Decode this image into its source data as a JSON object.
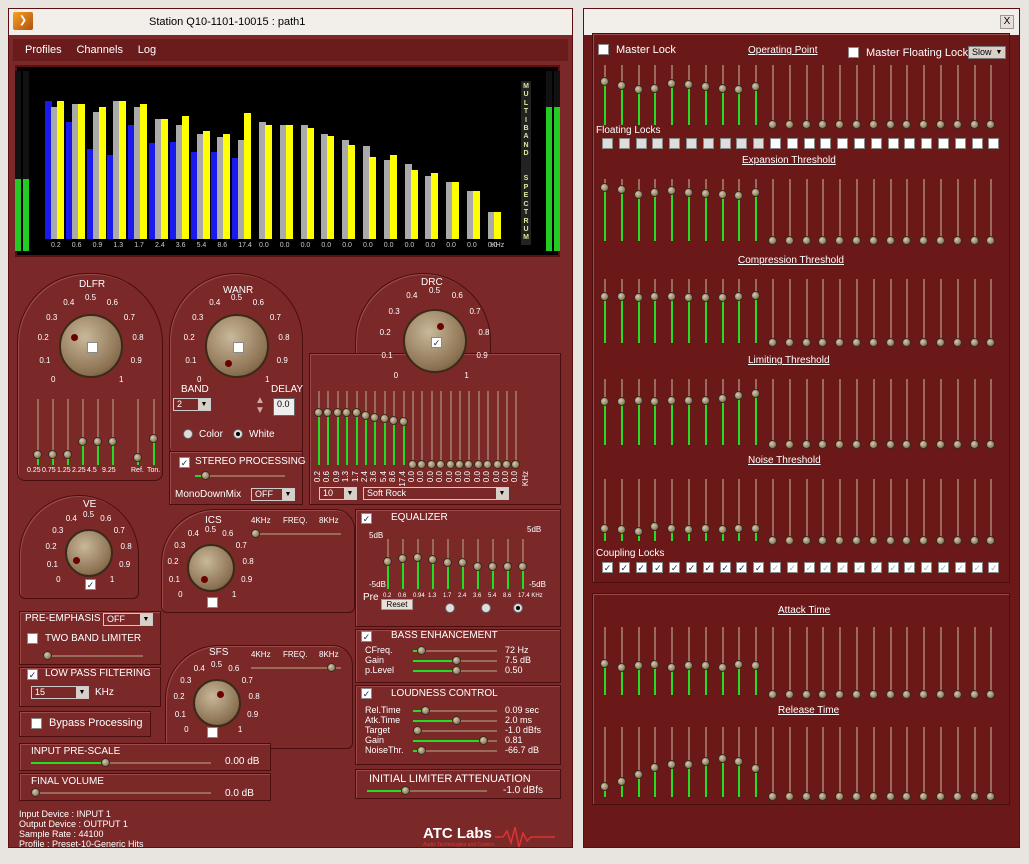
{
  "window": {
    "title": "Station  Q10-1101-10015 :  path1",
    "close": "X"
  },
  "menu": [
    "Profiles",
    "Channels",
    "Log"
  ],
  "spectrum": {
    "label": "MULTIBAND SPECTRUM",
    "freqs": [
      "0.2",
      "0.6",
      "0.9",
      "1.3",
      "1.7",
      "2.4",
      "3.6",
      "5.4",
      "8.6",
      "17.4",
      "0.0",
      "0.0",
      "0.0",
      "0.0",
      "0.0",
      "0.0",
      "0.0",
      "0.0",
      "0.0",
      "0.0",
      "0.0",
      "0.0"
    ],
    "unit": "KHz",
    "bars": [
      {
        "b": 0.92,
        "g": 0.88,
        "y": 0.92
      },
      {
        "b": 0.78,
        "g": 0.9,
        "y": 0.9
      },
      {
        "b": 0.6,
        "g": 0.85,
        "y": 0.88
      },
      {
        "b": 0.56,
        "g": 0.92,
        "y": 0.92
      },
      {
        "b": 0.76,
        "g": 0.88,
        "y": 0.9
      },
      {
        "b": 0.64,
        "g": 0.8,
        "y": 0.8
      },
      {
        "b": 0.65,
        "g": 0.76,
        "y": 0.82
      },
      {
        "b": 0.58,
        "g": 0.7,
        "y": 0.72
      },
      {
        "b": 0.58,
        "g": 0.68,
        "y": 0.7
      },
      {
        "b": 0.54,
        "g": 0.66,
        "y": 0.84
      },
      {
        "g": 0.78,
        "y": 0.76
      },
      {
        "g": 0.76,
        "y": 0.76
      },
      {
        "g": 0.76,
        "y": 0.74
      },
      {
        "g": 0.7,
        "y": 0.69
      },
      {
        "g": 0.66,
        "y": 0.63
      },
      {
        "g": 0.62,
        "y": 0.55
      },
      {
        "g": 0.53,
        "y": 0.56
      },
      {
        "g": 0.5,
        "y": 0.46
      },
      {
        "g": 0.42,
        "y": 0.44
      },
      {
        "g": 0.38,
        "y": 0.38
      },
      {
        "g": 0.32,
        "y": 0.32
      },
      {
        "g": 0.18,
        "y": 0.18
      }
    ]
  },
  "dlfr": {
    "title": "DLFR",
    "ticks": [
      "0",
      "0.1",
      "0.2",
      "0.3",
      "0.4",
      "0.5",
      "0.6",
      "0.7",
      "0.8",
      "0.9",
      "1"
    ],
    "bands": [
      "0.25",
      "0.75",
      "1.25",
      "2.25",
      "4.5",
      "9.25",
      "Ref.",
      "Ton."
    ],
    "levels": [
      0.15,
      0.15,
      0.15,
      0.35,
      0.35,
      0.35,
      0.1,
      0.4
    ]
  },
  "wanr": {
    "title": "WANR",
    "ticks": [
      "0",
      "0.1",
      "0.2",
      "0.3",
      "0.4",
      "0.5",
      "0.6",
      "0.7",
      "0.8",
      "0.9",
      "1"
    ],
    "band_label": "BAND",
    "band_value": "2",
    "delay_label": "DELAY",
    "delay_value": "0.0",
    "color": "Color",
    "white": "White"
  },
  "drc": {
    "title": "DRC",
    "ticks": [
      "0",
      "0.1",
      "0.2",
      "0.3",
      "0.4",
      "0.5",
      "0.6",
      "0.7",
      "0.8",
      "0.9",
      "1"
    ],
    "freqs": [
      "0.2",
      "0.6",
      "0.9",
      "1.3",
      "1.7",
      "2.4",
      "3.6",
      "5.4",
      "8.6",
      "17.4",
      "0.0",
      "0.0",
      "0.0",
      "0.0",
      "0.0",
      "0.0",
      "0.0",
      "0.0",
      "0.0",
      "0.0",
      "0.0",
      "0.0"
    ],
    "unit": "KHz",
    "levels": [
      0.7,
      0.7,
      0.7,
      0.7,
      0.7,
      0.66,
      0.64,
      0.62,
      0.6,
      0.58
    ],
    "preset_num": "10",
    "preset": "Soft Rock"
  },
  "stereo": {
    "label": "STEREO PROCESSING",
    "mono": "MonoDownMix",
    "mono_value": "OFF"
  },
  "ve": {
    "title": "VE",
    "ticks": [
      "0",
      "0.1",
      "0.2",
      "0.3",
      "0.4",
      "0.5",
      "0.6",
      "0.7",
      "0.8",
      "0.9",
      "1"
    ]
  },
  "ics": {
    "title": "ICS",
    "ticks": [
      "0",
      "0.1",
      "0.2",
      "0.3",
      "0.4",
      "0.5",
      "0.6",
      "0.7",
      "0.8",
      "0.9",
      "1"
    ],
    "f1": "4KHz",
    "f2": "FREQ.",
    "f3": "8KHz"
  },
  "sfs": {
    "title": "SFS",
    "ticks": [
      "0",
      "0.1",
      "0.2",
      "0.3",
      "0.4",
      "0.5",
      "0.6",
      "0.7",
      "0.8",
      "0.9",
      "1"
    ],
    "f1": "4KHz",
    "f2": "FREQ.",
    "f3": "8KHz"
  },
  "preemph": {
    "label": "PRE-EMPHASIS",
    "value": "OFF",
    "two_band": "TWO BAND LIMITER"
  },
  "lpf": {
    "label": "LOW PASS FILTERING",
    "value": "15",
    "unit": "KHz"
  },
  "bypass": "Bypass Processing",
  "prescale": {
    "label": "INPUT PRE-SCALE",
    "value": "0.00 dB"
  },
  "final": {
    "label": "FINAL VOLUME",
    "value": "0.0 dB"
  },
  "eq": {
    "label": "EQUALIZER",
    "top": "5dB",
    "left_top": "5dB",
    "bottom": "-5dB",
    "right_bottom": "-5dB",
    "pre": "Pre",
    "reset": "Reset",
    "freqs": [
      "0.2",
      "0.6",
      "0.94",
      "1.3",
      "1.7",
      "2.4",
      "3.6",
      "5.4",
      "8.6",
      "17.4 KHz"
    ],
    "levels": [
      0.55,
      0.6,
      0.62,
      0.58,
      0.52,
      0.52,
      0.45,
      0.45,
      0.45,
      0.45
    ]
  },
  "bass": {
    "label": "BASS ENHANCEMENT",
    "rows": [
      {
        "name": "CFreq.",
        "value": "72 Hz",
        "pos": 0.05
      },
      {
        "name": "Gain",
        "value": "7.5 dB",
        "pos": 0.5
      },
      {
        "name": "p.Level",
        "value": "0.50",
        "pos": 0.5
      }
    ]
  },
  "loud": {
    "label": "LOUDNESS CONTROL",
    "rows": [
      {
        "name": "Rel.Time",
        "value": "0.09 sec",
        "pos": 0.1
      },
      {
        "name": "Atk.Time",
        "value": "2.0 ms",
        "pos": 0.5
      },
      {
        "name": "Target",
        "value": "-1.0 dBfs",
        "pos": 0.0
      },
      {
        "name": "Gain",
        "value": "0.81",
        "pos": 0.85
      },
      {
        "name": "NoiseThr.",
        "value": "-66.7 dB",
        "pos": 0.05
      }
    ]
  },
  "initlim": {
    "label": "INITIAL LIMITER ATTENUATION",
    "value": "-1.0 dBfs"
  },
  "info": {
    "input": "Input Device : INPUT 1",
    "output": "Output Device : OUTPUT 1",
    "rate": "Sample Rate : 44100",
    "profile": "Profile : Preset-10-Generic Hits"
  },
  "brand": {
    "name": "ATC Labs",
    "sub": "Audio Technologies and Codecs"
  },
  "right": {
    "master_lock": "Master Lock",
    "operating_point": "Operating Point",
    "master_floating": "Master Floating Lock",
    "slow": "Slow",
    "floating_locks": "Floating Locks",
    "expansion": "Expansion Threshold",
    "compression": "Compression Threshold",
    "limiting": "Limiting Threshold",
    "noise": "Noise Threshold",
    "coupling": "Coupling Locks",
    "attack": "Attack Time",
    "release": "Release Time",
    "op_levels": [
      0.72,
      0.65,
      0.58,
      0.6,
      0.68,
      0.66,
      0.64,
      0.6,
      0.58,
      0.64
    ],
    "exp_levels": [
      0.85,
      0.82,
      0.75,
      0.78,
      0.8,
      0.78,
      0.76,
      0.74,
      0.72,
      0.78
    ],
    "comp_levels": [
      0.72,
      0.72,
      0.7,
      0.72,
      0.72,
      0.7,
      0.7,
      0.7,
      0.72,
      0.74
    ],
    "lim_levels": [
      0.65,
      0.65,
      0.66,
      0.65,
      0.66,
      0.66,
      0.66,
      0.7,
      0.74,
      0.78
    ],
    "noise_levels": [
      0.2,
      0.18,
      0.15,
      0.22,
      0.2,
      0.18,
      0.2,
      0.18,
      0.2,
      0.2
    ],
    "att_levels": [
      0.45,
      0.4,
      0.42,
      0.44,
      0.4,
      0.42,
      0.42,
      0.4,
      0.44,
      0.42
    ],
    "rel_levels": [
      0.15,
      0.22,
      0.32,
      0.42,
      0.46,
      0.46,
      0.5,
      0.54,
      0.5,
      0.4
    ]
  }
}
